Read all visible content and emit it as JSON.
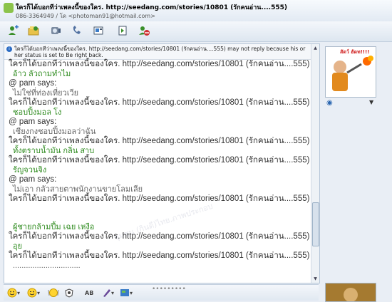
{
  "window": {
    "title": "ใครก็ได้บอกทีว่าเพลงนี้ของใคร.  http://seedang.com/stories/10801  (รักคนอ่าน....555)",
    "subtitle": "086-3364949 / โด <photoman91@hotmail.com>"
  },
  "toolbar": {
    "icons": [
      "add-contact-icon",
      "share-files-icon",
      "video-icon",
      "call-icon",
      "activities-icon",
      "games-icon",
      "block-icon"
    ]
  },
  "notice": "ใครก็ได้บอกทีว่าเพลงนี้ของใคร.  http://seedang.com/stories/10801  (รักคนอ่าน....555) may not reply because his or her status is set to Be right back.",
  "messages": [
    {
      "type": "says",
      "text": "ใครก็ได้บอกทีว่าเพลงนี้ของใคร.  http://seedang.com/stories/10801  (รักคนอ่าน....555) says:"
    },
    {
      "type": "msg",
      "text": "อ้าว  ลัวถามทำไม",
      "color": "green"
    },
    {
      "type": "says",
      "text": "@ pam says:"
    },
    {
      "type": "msg",
      "text": "ไม่ใช่ที่ท่องเที่ยวเวีย",
      "color": "gray"
    },
    {
      "type": "says",
      "text": "ใครก็ได้บอกทีว่าเพลงนี้ของใคร.  http://seedang.com/stories/10801  (รักคนอ่าน....555) says:"
    },
    {
      "type": "msg",
      "text": "ชอบปิ้งมอล โง",
      "color": "green"
    },
    {
      "type": "says",
      "text": "@ pam says:"
    },
    {
      "type": "msg",
      "text": "เชียงกงชอบปิ้งมอลว่าฉัน",
      "color": "gray"
    },
    {
      "type": "says",
      "text": "ใครก็ได้บอกทีว่าเพลงนี้ของใคร.  http://seedang.com/stories/10801  (รักคนอ่าน....555) says:"
    },
    {
      "type": "msg",
      "text": "ทั้งตราบน้ำมัน กลิ่น สาบ",
      "color": "green"
    },
    {
      "type": "says",
      "text": "ใครก็ได้บอกทีว่าเพลงนี้ของใคร.  http://seedang.com/stories/10801  (รักคนอ่าน....555) says:"
    },
    {
      "type": "msg",
      "text": "รัญจวนจิง",
      "color": "green"
    },
    {
      "type": "says",
      "text": "@ pam says:"
    },
    {
      "type": "msg",
      "text": "ไม่เอา กลัวสายตาพนักงานขายโลมเลีย",
      "color": "gray"
    },
    {
      "type": "says",
      "text": "ใครก็ได้บอกทีว่าเพลงนี้ของใคร.  http://seedang.com/stories/10801  (รักคนอ่าน....555) says:"
    },
    {
      "type": "spacer",
      "text": ""
    },
    {
      "type": "msg",
      "text": "ผู้ชายกล้ามปึ้ม   เฉย        เหงือ",
      "color": "green"
    },
    {
      "type": "says",
      "text": "ใครก็ได้บอกทีว่าเพลงนี้ของใคร.  http://seedang.com/stories/10801  (รักคนอ่าน....555) says:"
    },
    {
      "type": "msg",
      "text": "อุย",
      "color": "green"
    },
    {
      "type": "says",
      "text": "ใครก็ได้บอกทีว่าเพลงนี้ของใคร.  http://seedang.com/stories/10801  (รักคนอ่าน....555) says:"
    },
    {
      "type": "msg",
      "text": "...............................",
      "color": "gray"
    }
  ],
  "bottom": {
    "icons": [
      "emoticon-icon",
      "wink-icon",
      "nudge-icon",
      "voice-clip-icon",
      "font-icon",
      "color-icon",
      "background-icon"
    ],
    "font_label": "AB"
  },
  "sidebar": {
    "avatar_text": "สัตว์ ฮัดท!!!!",
    "webcam_icon": "webcam-icon"
  },
  "watermark": "ชุมชน (กินดี)ไทย.ภาพประกอบ"
}
